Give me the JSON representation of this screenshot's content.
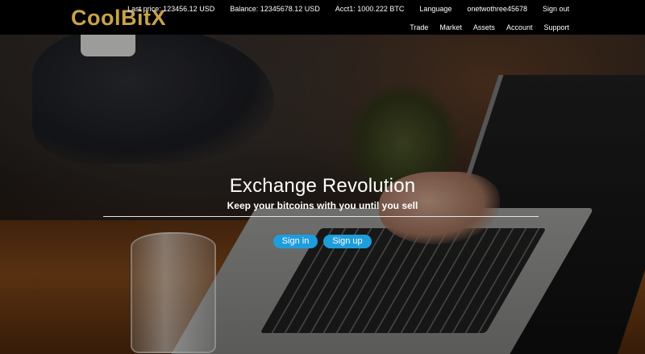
{
  "brand": {
    "logo_text": "CoolBitX",
    "accent": "#c9a24a"
  },
  "header": {
    "status_items": [
      {
        "label": "Last price: 123456.12 USD"
      },
      {
        "label": "Balance: 12345678.12 USD"
      },
      {
        "label": "Acct1: 1000.222 BTC"
      },
      {
        "label": "Language"
      },
      {
        "label": "onetwothree45678"
      },
      {
        "label": "Sign out"
      }
    ],
    "nav_items": [
      {
        "label": "Trade"
      },
      {
        "label": "Market"
      },
      {
        "label": "Assets"
      },
      {
        "label": "Account"
      },
      {
        "label": "Support"
      }
    ]
  },
  "hero": {
    "title": "Exchange Revolution",
    "subtitle": "Keep your bitcoins with you until you sell",
    "signin_label": "Sign in",
    "signup_label": "Sign up",
    "button_color": "#1e9ddb"
  }
}
